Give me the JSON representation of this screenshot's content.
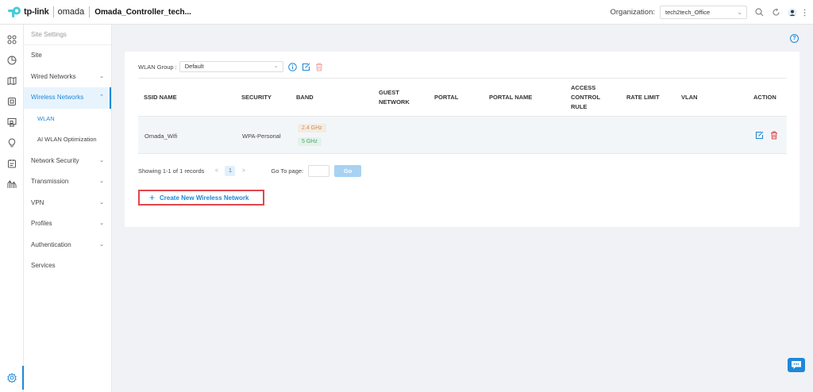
{
  "header": {
    "brand": "tp-link",
    "product": "omada",
    "controller_name": "Omada_Controller_tech...",
    "org_label": "Organization:",
    "org_value": "tech2tech_Office",
    "icons": [
      "search-icon",
      "refresh-icon",
      "user-avatar-icon",
      "more-vertical-icon"
    ]
  },
  "rail": {
    "icons": [
      "dashboard-icon",
      "statistics-icon",
      "map-icon",
      "devices-icon",
      "clients-icon",
      "insight-icon",
      "log-icon",
      "report-icon"
    ],
    "bottom_icon": "settings-gear-icon"
  },
  "submenu": {
    "header": "Site Settings",
    "items": [
      {
        "label": "Site"
      },
      {
        "label": "Wired Networks",
        "chevron": "v"
      },
      {
        "label": "Wireless Networks",
        "chevron": "^"
      },
      {
        "label": "WLAN"
      },
      {
        "label": "AI WLAN Optimization"
      },
      {
        "label": "Network Security",
        "chevron": "v"
      },
      {
        "label": "Transmission",
        "chevron": "v"
      },
      {
        "label": "VPN",
        "chevron": "v"
      },
      {
        "label": "Profiles",
        "chevron": "v"
      },
      {
        "label": "Authentication",
        "chevron": "v"
      },
      {
        "label": "Services"
      }
    ]
  },
  "main": {
    "wlan_group_label": "WLAN Group :",
    "wlan_group_value": "Default",
    "columns": [
      "SSID NAME",
      "SECURITY",
      "BAND",
      "GUEST NETWORK",
      "PORTAL",
      "PORTAL NAME",
      "ACCESS CONTROL RULE",
      "RATE LIMIT",
      "VLAN",
      "ACTION"
    ],
    "rows": [
      {
        "ssid": "Omada_Wifi",
        "security": "WPA-Personal",
        "bands": [
          "2.4 GHz",
          "5 GHz"
        ]
      }
    ],
    "pager": {
      "summary": "Showing 1-1 of 1 records",
      "prev": "<",
      "page": "1",
      "next": ">",
      "goto_label": "Go To page:",
      "go_label": "Go"
    },
    "create_label": "Create New Wireless Network",
    "create_plus": "+"
  },
  "colors": {
    "accent": "#1e88d8",
    "danger": "#e0474c",
    "band_24": "#d98b45",
    "band_5": "#42a86b"
  }
}
